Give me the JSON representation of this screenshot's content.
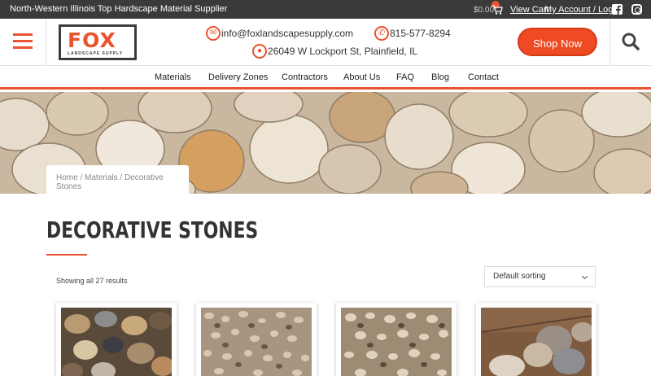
{
  "topbar": {
    "tagline": "North-Western Illinois Top Hardscape Material Supplier",
    "cart_total": "$0.00",
    "view_cart": "View Cart",
    "account": "My Account / Login"
  },
  "header": {
    "logo_text": "FOX",
    "logo_sub": "LANDSCAPE SUPPLY",
    "email": "info@foxlandscapesupply.com",
    "phone": "815-577-8294",
    "address": "26049 W Lockport St, Plainfield, IL",
    "shop_now": "Shop Now"
  },
  "nav": {
    "items": [
      "Materials",
      "Delivery Zones",
      "Contractors",
      "About Us",
      "FAQ",
      "Blog",
      "Contact"
    ]
  },
  "breadcrumb": {
    "home": "Home",
    "sep": " / ",
    "materials": "Materials",
    "current": "Decorative Stones"
  },
  "page": {
    "title": "DECORATIVE STONES",
    "results": "Showing all 27 results",
    "sort_selected": "Default sorting"
  },
  "colors": {
    "accent": "#e8542f",
    "topbar_bg": "#3a3a3a",
    "text": "#333333"
  },
  "icons": [
    "hamburger-icon",
    "cart-icon",
    "facebook-icon",
    "instagram-icon",
    "email-icon",
    "phone-icon",
    "location-icon",
    "search-icon",
    "chevron-down-icon"
  ]
}
